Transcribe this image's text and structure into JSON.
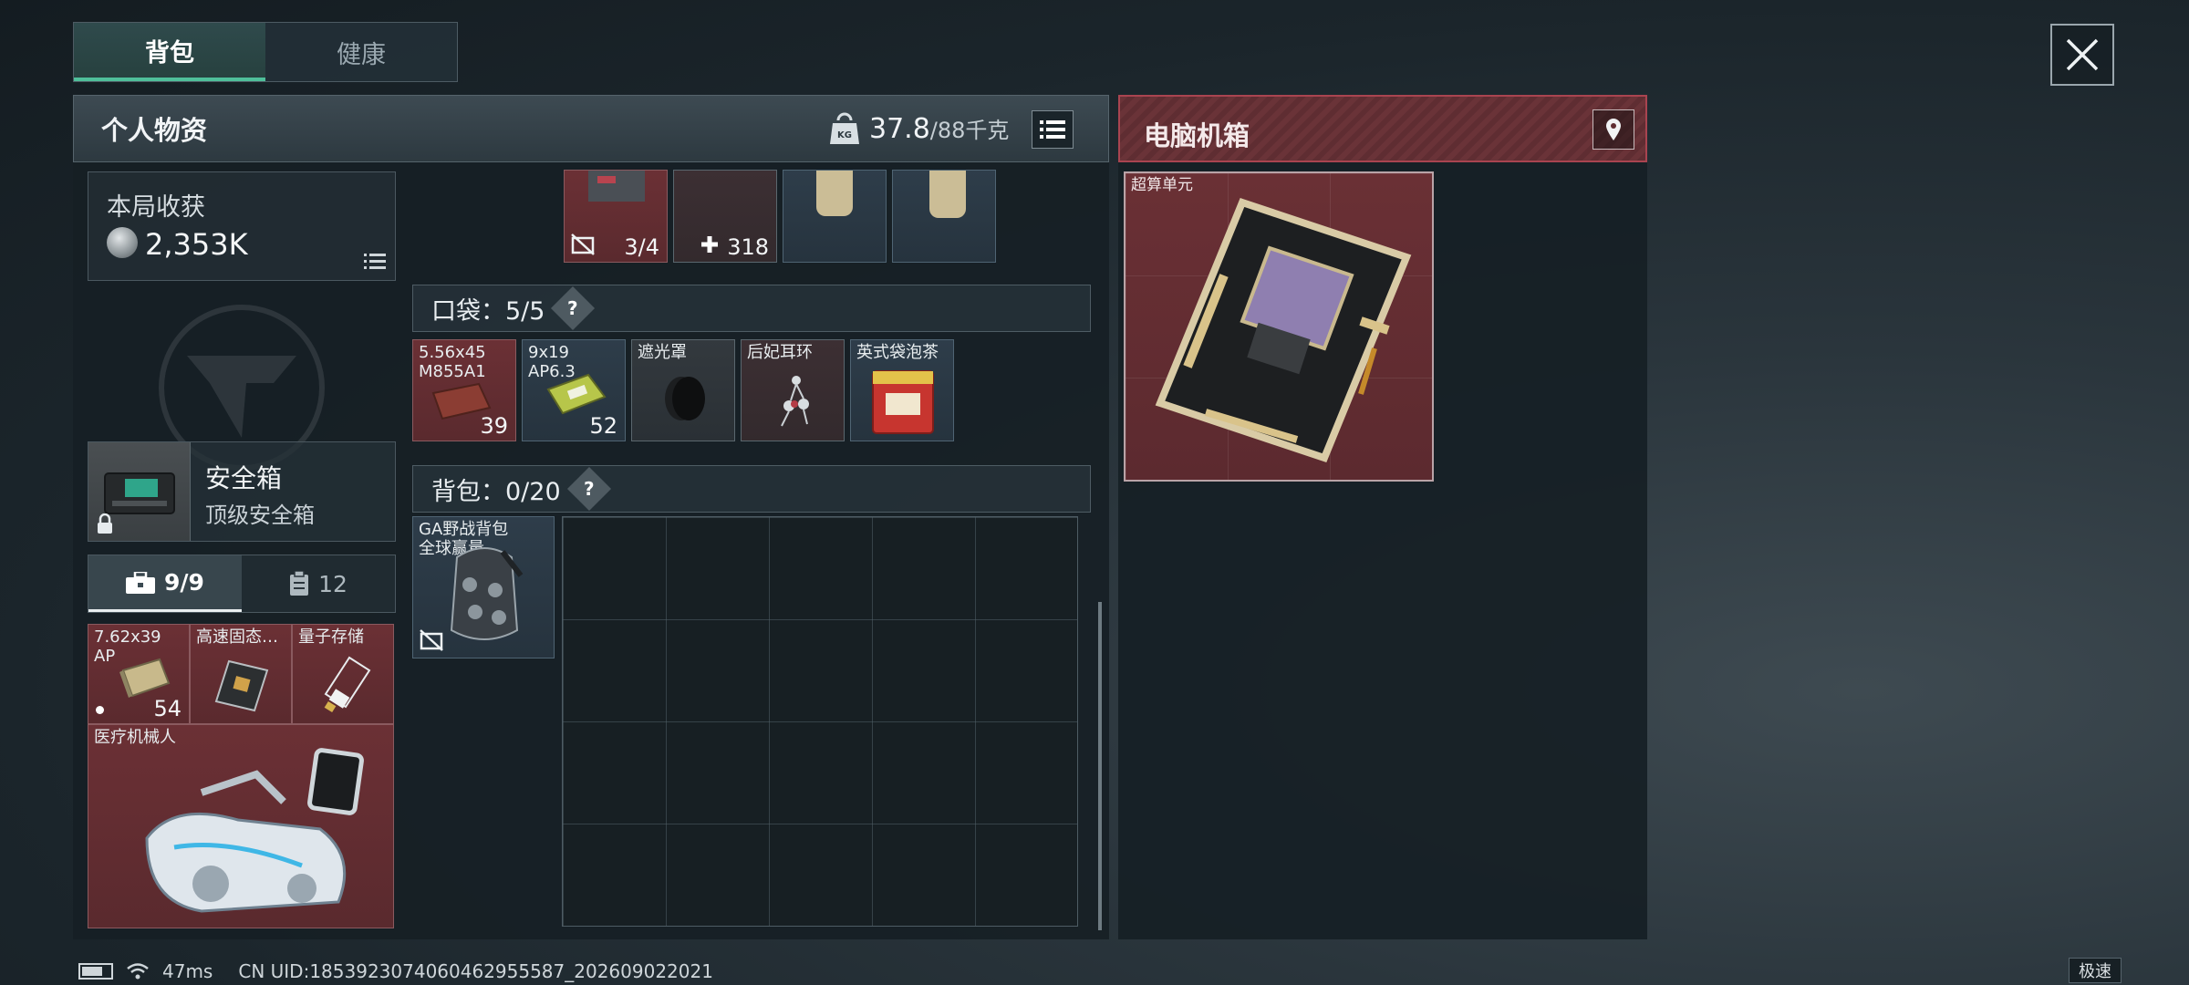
{
  "tabs": [
    {
      "label": "背包",
      "active": true
    },
    {
      "label": "健康",
      "active": false
    }
  ],
  "personal": {
    "title": "个人物资",
    "weight_current": "37.8",
    "weight_capacity": "/88千克",
    "weight_icon_text": "KG"
  },
  "harvest": {
    "label": "本局收获",
    "value": "2,353K"
  },
  "safe": {
    "title": "安全箱",
    "subtitle": "顶级安全箱"
  },
  "seg_tabs": [
    {
      "label": "9/9",
      "icon": "toolbox-icon",
      "active": true
    },
    {
      "label": "12",
      "icon": "clipboard-icon",
      "active": false
    }
  ],
  "safe_items": [
    {
      "label": "7.62x39\nAP",
      "count": "54"
    },
    {
      "label": "高速固态…",
      "count": ""
    },
    {
      "label": "量子存储",
      "count": ""
    },
    {
      "label": "医疗机械人",
      "count": ""
    }
  ],
  "top_row": {
    "durability": "3/4",
    "plus_value": "318"
  },
  "pocket": {
    "label": "口袋：",
    "value": "5/5",
    "help": "?"
  },
  "pocket_items": [
    {
      "label": "5.56x45\nM855A1",
      "count": "39"
    },
    {
      "label": "9x19\nAP6.3",
      "count": "52"
    },
    {
      "label": "遮光罩",
      "count": ""
    },
    {
      "label": "后妃耳环",
      "count": ""
    },
    {
      "label": "英式袋泡茶",
      "count": ""
    }
  ],
  "backpack": {
    "label": "背包：",
    "value": "0/20",
    "help": "?",
    "equipped_label": "GA野战背包\n全球赢量"
  },
  "pc_case": {
    "title": "电脑机箱",
    "item_label": "超算单元"
  },
  "status": {
    "ping": "47ms",
    "uid": "CN UID:1853923074060462955587_202609022021",
    "speed": "极速"
  },
  "colors": {
    "accent_green": "#4fbf9a",
    "rarity_red": "#6b3035",
    "pc_case_border": "#a94450"
  }
}
